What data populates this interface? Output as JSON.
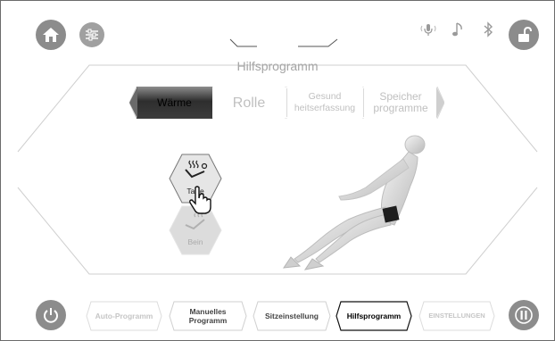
{
  "header": {
    "title": "Hilfsprogramm",
    "icons": [
      "home-icon",
      "sliders-icon",
      "microphone-icon",
      "music-note-icon",
      "bluetooth-icon",
      "unlock-icon"
    ]
  },
  "tabs": [
    {
      "label": "Wärme",
      "active": true
    },
    {
      "label": "Rolle",
      "active": false
    },
    {
      "label": "Gesund heitserfassung",
      "active": false
    },
    {
      "label": "Speicher programme",
      "active": false
    }
  ],
  "body_zones": [
    {
      "label": "Taille",
      "enabled": true
    },
    {
      "label": "Bein",
      "enabled": false
    }
  ],
  "bottom_nav": [
    {
      "label": "Auto-Programm",
      "state": "disabled"
    },
    {
      "label": "Manuelles Programm",
      "state": "normal"
    },
    {
      "label": "Sitzeinstellung",
      "state": "normal"
    },
    {
      "label": "Hilfsprogramm",
      "state": "active"
    },
    {
      "label": "EINSTELLUNGEN",
      "state": "disabled"
    }
  ],
  "colors": {
    "button_gray": "#8c8c8c",
    "active_tab_top": "#8d8d8d",
    "active_tab_bottom": "#2e2e2e",
    "line_gray": "#c8c8c8"
  }
}
